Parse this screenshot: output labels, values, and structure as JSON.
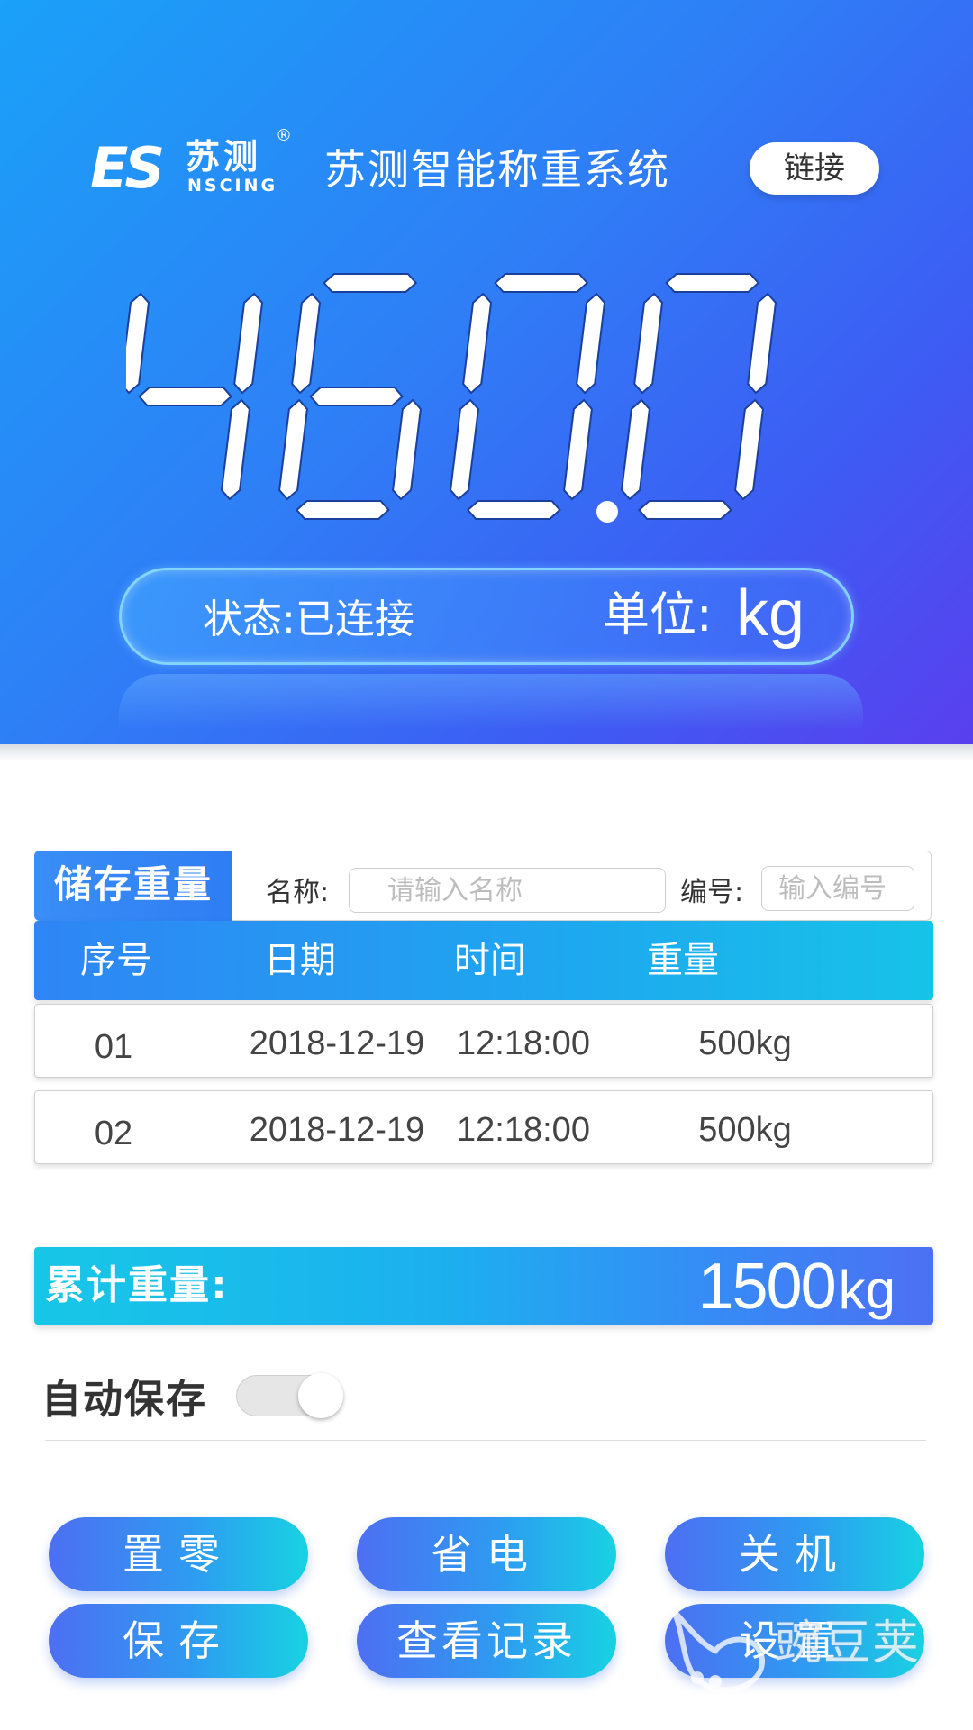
{
  "header": {
    "logo": {
      "mark": "ES",
      "brand_cn": "苏测",
      "brand_en": "NSCING",
      "reg": "®"
    },
    "title": "苏测智能称重系统",
    "connect_label": "链接"
  },
  "display": {
    "weight": "460.0",
    "status": "状态:已连接",
    "unit_label": "单位:",
    "unit": "kg"
  },
  "storage": {
    "title": "储存重量",
    "name_label": "名称:",
    "name_placeholder": "请输入名称",
    "code_label": "编号:",
    "code_placeholder": "输入编号"
  },
  "table": {
    "headers": [
      "序号",
      "日期",
      "时间",
      "重量"
    ],
    "rows": [
      [
        "01",
        "2018-12-19",
        "12:18:00",
        "500kg"
      ],
      [
        "02",
        "2018-12-19",
        "12:18:00",
        "500kg"
      ]
    ]
  },
  "total": {
    "label": "累计重量:",
    "value": "1500",
    "unit": "kg"
  },
  "auto_save": {
    "label": "自动保存",
    "enabled": false
  },
  "buttons": {
    "zero": "置零",
    "power_save": "省电",
    "shutdown": "关机",
    "save": "保存",
    "records": "查看记录",
    "settings": "设置"
  },
  "watermark": {
    "text": "豌豆荚"
  },
  "colors": {
    "accent_blue": "#2f7ef6",
    "accent_cyan": "#17c7e6",
    "accent_violet": "#5a3fee"
  }
}
